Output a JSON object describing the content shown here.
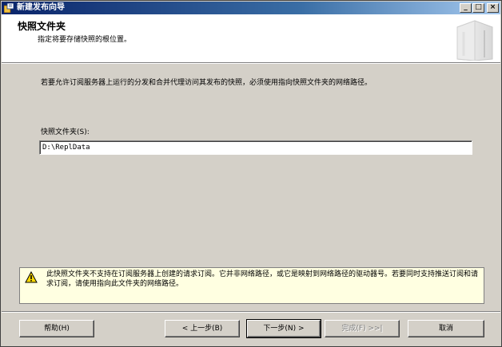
{
  "window": {
    "title": "新建发布向导",
    "controls": [
      "_",
      "□",
      "×"
    ]
  },
  "header": {
    "title": "快照文件夹",
    "subtitle": "指定将要存储快照的根位置。"
  },
  "main": {
    "description": "若要允许订阅服务器上运行的分发和合并代理访问其发布的快照，必须使用指向快照文件夹的网络路径。",
    "field_label": "快照文件夹(S):",
    "folder_value": "D:\\ReplData"
  },
  "warning": {
    "text": "此快照文件夹不支持在订阅服务器上创建的请求订阅。它并非网络路径，或它是映射到网络路径的驱动器号。若要同时支持推送订阅和请求订阅，请使用指向此文件夹的网络路径。"
  },
  "buttons": {
    "help": "帮助(H)",
    "back": "< 上一步(B)",
    "next": "下一步(N) >",
    "finish": "完成(F) >>|",
    "cancel": "取消"
  }
}
